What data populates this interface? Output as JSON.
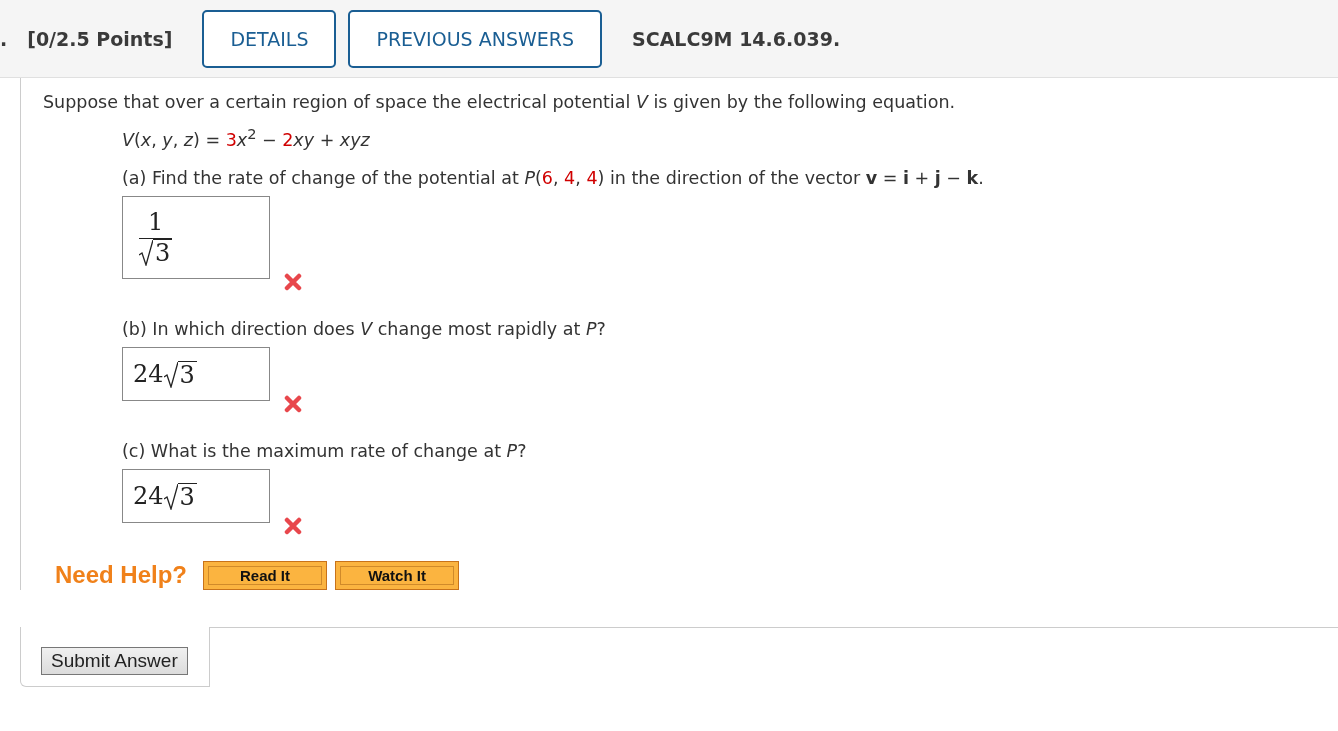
{
  "header": {
    "number": ".",
    "points": "[0/2.5 Points]",
    "buttons": [
      "DETAILS",
      "PREVIOUS ANSWERS"
    ],
    "code": "SCALC9M 14.6.039."
  },
  "intro": "Suppose that over a certain region of space the electrical potential *V* is given by the following equation.",
  "equation": [
    {
      "kind": "text",
      "text": "*V*(*x*, *y*, *z*) = "
    },
    {
      "kind": "value",
      "text": "3"
    },
    {
      "kind": "text",
      "text": "*x*$^{2}$ − "
    },
    {
      "kind": "value",
      "text": "2"
    },
    {
      "kind": "text",
      "text": "*xy* + *xyz*"
    }
  ],
  "parts": [
    {
      "prompt": [
        {
          "kind": "text",
          "text": "(a) Find the rate of change of the potential at *P*("
        },
        {
          "kind": "value",
          "text": "6"
        },
        {
          "kind": "text",
          "text": ", "
        },
        {
          "kind": "value",
          "text": "4"
        },
        {
          "kind": "text",
          "text": ", "
        },
        {
          "kind": "value",
          "text": "4"
        },
        {
          "kind": "text",
          "text": ") in the direction of the vector **v** = **i** + **j** − **k**."
        }
      ],
      "answer": {
        "kind": "fraction",
        "numerator": "1",
        "radicand": "3"
      },
      "correct": false
    },
    {
      "prompt": [
        {
          "kind": "text",
          "text": "(b) In which direction does *V* change most rapidly at *P*?"
        }
      ],
      "answer": {
        "kind": "radical",
        "coefficient": "24",
        "radicand": "3"
      },
      "correct": false
    },
    {
      "prompt": [
        {
          "kind": "text",
          "text": "(c) What is the maximum rate of change at *P*?"
        }
      ],
      "answer": {
        "kind": "radical",
        "coefficient": "24",
        "radicand": "3"
      },
      "correct": false
    }
  ],
  "help": {
    "label": "Need Help?",
    "buttons": [
      "Read It",
      "Watch It"
    ]
  },
  "submit": "Submit Answer"
}
